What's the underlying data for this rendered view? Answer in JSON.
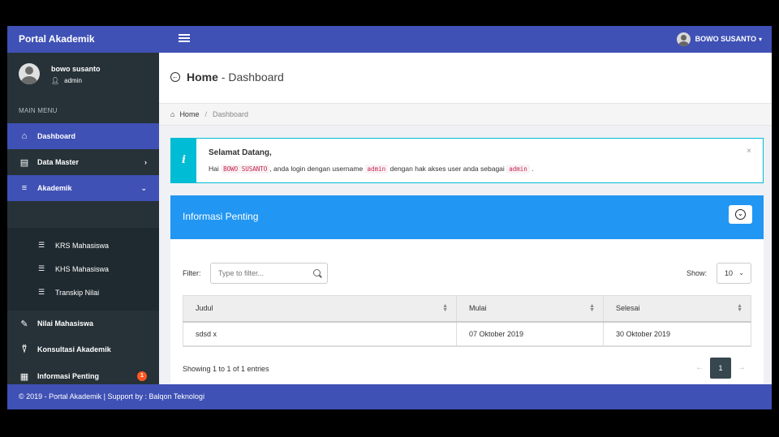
{
  "app": {
    "brand": "Portal Akademik"
  },
  "topbar": {
    "user_name": "BOWO SUSANTO"
  },
  "sidebar": {
    "profile_name": "bowo susanto",
    "profile_role": "admin",
    "menu_header": "MAIN MENU",
    "items": [
      {
        "label": "Dashboard",
        "icon": "home-icon"
      },
      {
        "label": "Data Master",
        "icon": "table-icon"
      },
      {
        "label": "Akademik",
        "icon": "toggle-icon"
      },
      {
        "label": "Nilai Mahasiswa",
        "icon": "edit-icon"
      },
      {
        "label": "Konsultasi Akademik",
        "icon": "broadcast-icon"
      },
      {
        "label": "Informasi Penting",
        "icon": "newspaper-icon",
        "badge": "1"
      }
    ],
    "submenu": [
      {
        "label": "KRS Mahasiswa",
        "icon": "list-icon"
      },
      {
        "label": "KHS Mahasiswa",
        "icon": "list-icon"
      },
      {
        "label": "Transkip Nilai",
        "icon": "list-icon"
      }
    ]
  },
  "header": {
    "title": "Home",
    "subtitle": "- Dashboard"
  },
  "breadcrumb": {
    "home": "Home",
    "separator": "/",
    "current": "Dashboard"
  },
  "callout": {
    "title": "Selamat Datang,",
    "text_1": "Hai",
    "user": "BOWO SUSANTO",
    "text_2": ", anda login dengan username",
    "username": "admin",
    "text_3": "dengan hak akses user anda sebagai",
    "role": "admin",
    "text_4": "."
  },
  "panel": {
    "title": "Informasi Penting",
    "filter_label": "Filter:",
    "filter_placeholder": "Type to filter...",
    "show_label": "Show:",
    "show_value": "10",
    "columns": [
      "Judul",
      "Mulai",
      "Selesai"
    ],
    "rows": [
      [
        "sdsd x",
        "07 Oktober 2019",
        "30 Oktober 2019"
      ]
    ],
    "info": "Showing 1 to 1 of 1 entries",
    "pagination": {
      "prev": "←",
      "current": "1",
      "next": "→"
    }
  },
  "footer": {
    "text": "© 2019 - Portal Akademik | Support by : Balqon Teknologi"
  },
  "colors": {
    "primary": "#3f51b5",
    "sidebar": "#263238",
    "info": "#00bcd4",
    "panel_head": "#2196f3",
    "badge": "#ff5722"
  }
}
